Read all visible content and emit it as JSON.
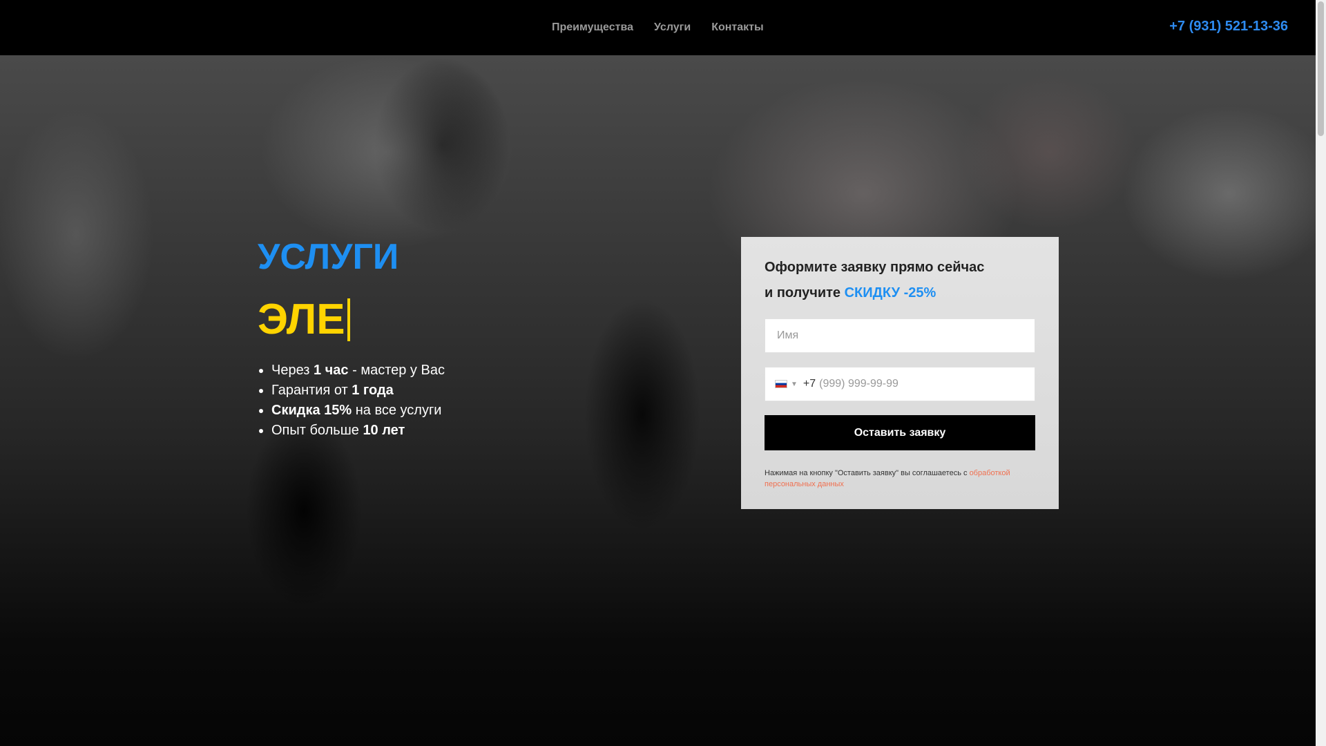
{
  "header": {
    "nav": [
      "Преимущества",
      "Услуги",
      "Контакты"
    ],
    "phone": "+7 (931) 521-13-36"
  },
  "hero": {
    "title": "УСЛУГИ",
    "subtitle": "ЭЛЕ",
    "benefits": [
      {
        "pre": "Через ",
        "bold": "1 час",
        "post": " - мастер у Вас"
      },
      {
        "pre": "Гарантия от ",
        "bold": "1 года",
        "post": ""
      },
      {
        "pre": "",
        "bold": "Скидка 15%",
        "post": " на все услуги"
      },
      {
        "pre": "Опыт больше ",
        "bold": "10 лет",
        "post": ""
      }
    ]
  },
  "form": {
    "title_line1": "Оформите заявку прямо сейчас",
    "title_line2_pre": "и получите ",
    "title_line2_accent": "СКИДКУ -25%",
    "name_placeholder": "Имя",
    "phone_prefix": "+7",
    "phone_placeholder": "(999) 999-99-99",
    "country": "RU",
    "submit_label": "Оставить заявку",
    "consent_text": "Нажимая на кнопку \"Оставить заявку\" вы соглашаетесь с ",
    "consent_link": "обработкой персональных данных"
  },
  "colors": {
    "accent_blue": "#1e8ff2",
    "accent_yellow": "#ffd400",
    "link_orange": "#f07050"
  }
}
